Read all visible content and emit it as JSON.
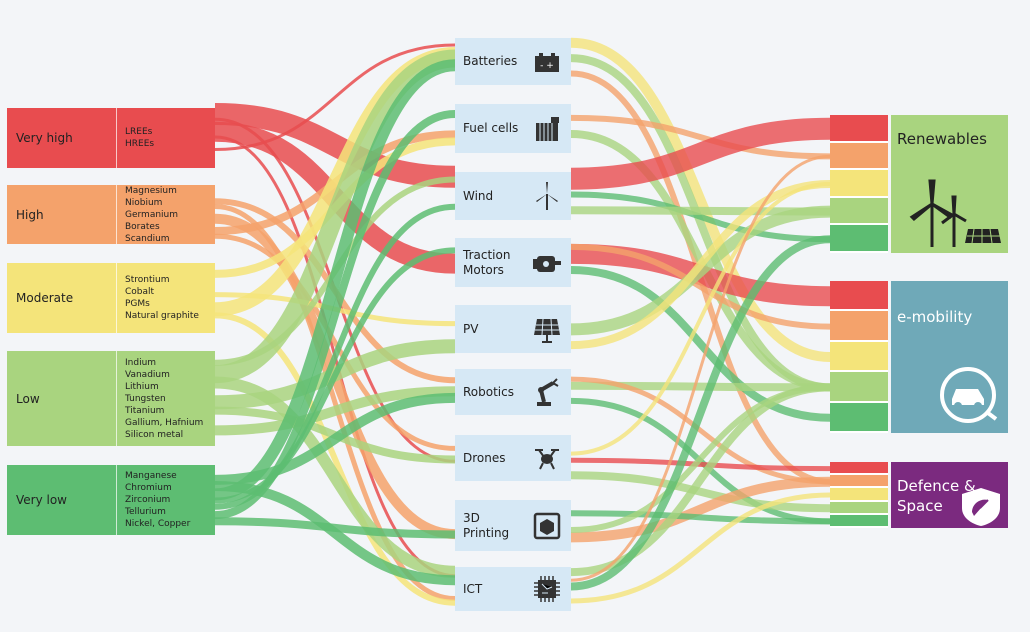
{
  "colors": {
    "very_high": "#e84c4f",
    "high": "#f4a26b",
    "moderate": "#f4e47a",
    "low": "#a9d47f",
    "very_low": "#5dbd72",
    "tech_bg": "#d6e8f5",
    "renewables": "#a9d47f",
    "e_mobility": "#6fa9b8",
    "defence": "#7b2a7f"
  },
  "tiers": [
    {
      "label": "Very high",
      "materials": [
        "LREEs",
        "HREEs"
      ]
    },
    {
      "label": "High",
      "materials": [
        "Magnesium",
        "Niobium",
        "Germanium",
        "Borates",
        "Scandium"
      ]
    },
    {
      "label": "Moderate",
      "materials": [
        "Strontium",
        "Cobalt",
        "PGMs",
        "Natural graphite"
      ]
    },
    {
      "label": "Low",
      "materials": [
        "Indium",
        "Vanadium",
        "Lithium",
        "Tungsten",
        "Titanium",
        "Gallium, Hafnium",
        "Silicon metal"
      ]
    },
    {
      "label": "Very low",
      "materials": [
        "Manganese",
        "Chromium",
        "Zirconium",
        "Tellurium",
        "Nickel, Copper"
      ]
    }
  ],
  "technologies": [
    {
      "label": "Batteries",
      "icon": "battery-icon"
    },
    {
      "label": "Fuel cells",
      "icon": "fuel-cell-icon"
    },
    {
      "label": "Wind",
      "icon": "wind-turbine-icon"
    },
    {
      "label": "Traction Motors",
      "icon": "motor-icon"
    },
    {
      "label": "PV",
      "icon": "solar-panel-icon"
    },
    {
      "label": "Robotics",
      "icon": "robot-arm-icon"
    },
    {
      "label": "Drones",
      "icon": "drone-icon"
    },
    {
      "label": "3D Printing",
      "icon": "3d-printer-icon"
    },
    {
      "label": "ICT",
      "icon": "chip-icon"
    }
  ],
  "sectors": [
    {
      "label": "Renewables",
      "icon": "wind-solar-icon"
    },
    {
      "label": "e-mobility",
      "icon": "electric-car-icon"
    },
    {
      "label": "Defence & Space",
      "icon": "satellite-shield-icon"
    }
  ]
}
